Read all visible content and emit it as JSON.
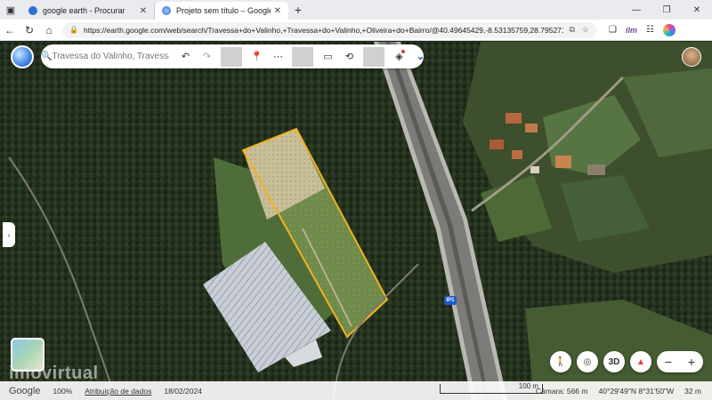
{
  "browser": {
    "tabs": [
      {
        "label": "google earth - Procurar",
        "active": false
      },
      {
        "label": "Projeto sem título – Google Earth",
        "active": true
      }
    ],
    "url": "https://earth.google.com/web/search/Travessa+do+Valinho,+Travessa+do+Valinho,+Oliveira+do+Bairro/@40.49645429,-8.53135759,28.795271..."
  },
  "earth": {
    "search_placeholder": "Travessa do Valinho, Travessa do",
    "highway_label": "IP1",
    "watermark": "imovirtual"
  },
  "statusbar": {
    "logo": "Google",
    "zoom": "100%",
    "attribution": "Atribuição de dados",
    "date": "18/02/2024",
    "scale": "100 m",
    "camera": "Câmara: 566 m",
    "coords": "40°29'49\"N 8°31'50\"W",
    "altitude": "32 m"
  },
  "controls": {
    "view_3d": "3D"
  },
  "colors": {
    "plot_outline": "#f2b21c",
    "accent": "#1a56c4"
  }
}
